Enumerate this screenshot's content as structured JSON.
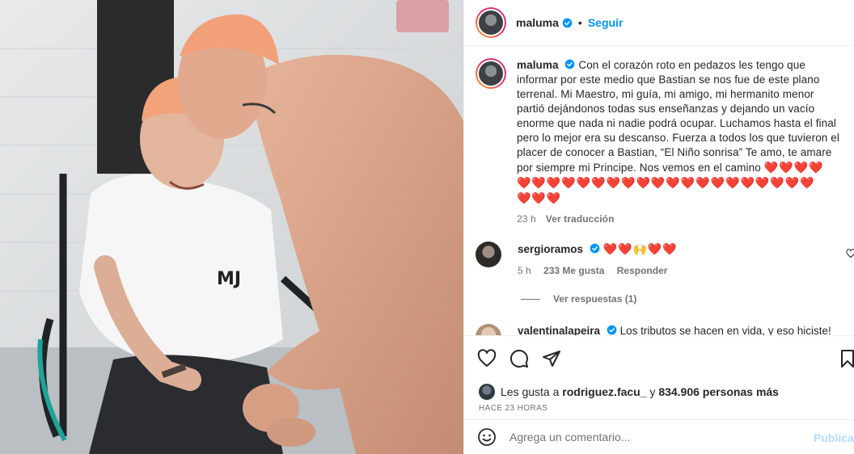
{
  "post": {
    "username": "maluma",
    "follow_label": "Seguir",
    "dot": "•"
  },
  "caption": {
    "username": "maluma",
    "text": "Con el corazón roto en pedazos les tengo que informar por este medio que Bastian se nos fue de este plano terrenal. Mi Maestro, mi guía, mi amigo, mi hermanito menor partió dejándonos todas sus enseñanzas y dejando un vacío enorme que nada ni nadie podrá ocupar. Luchamos hasta el final pero lo mejor era su descanso. Fuerza a todos los que tuvieron el placer de conocer a Bastian, “El Niño sonrisa” Te amo, te amare por siempre mi Principe. Nos vemos en el camino",
    "hearts_inline": "❤️❤️❤️❤️",
    "hearts_row2": "❤️❤️❤️❤️❤️❤️❤️❤️❤️❤️❤️❤️❤️❤️❤️❤️❤️❤️❤️❤️",
    "hearts_row3": "❤️❤️❤️",
    "time": "23 h",
    "translate_label": "Ver traducción"
  },
  "comments": [
    {
      "username": "sergioramos",
      "text": "❤️❤️🙌❤️❤️",
      "time": "5 h",
      "likes": "233 Me gusta",
      "reply_label": "Responder",
      "view_replies": "Ver respuestas (1)"
    },
    {
      "username": "valentinalapeira",
      "text": "Los tributos se hacen en vida, y eso hiciste!"
    }
  ],
  "likes": {
    "prefix": "Les gusta a",
    "user": "rodriguez.facu_",
    "connector": "y",
    "others": "834.906 personas más"
  },
  "time_ago": "HACE 23 HORAS",
  "add_comment": {
    "placeholder": "Agrega un comentario...",
    "publish_label": "Publicar"
  },
  "colors": {
    "accent": "#0095f6",
    "verified": "#0095f6",
    "heart": "#e0182d",
    "publish_disabled": "#b3dbff"
  },
  "icons": [
    "verified-icon",
    "heart-icon",
    "comment-icon",
    "share-icon",
    "bookmark-icon",
    "emoji-icon"
  ]
}
